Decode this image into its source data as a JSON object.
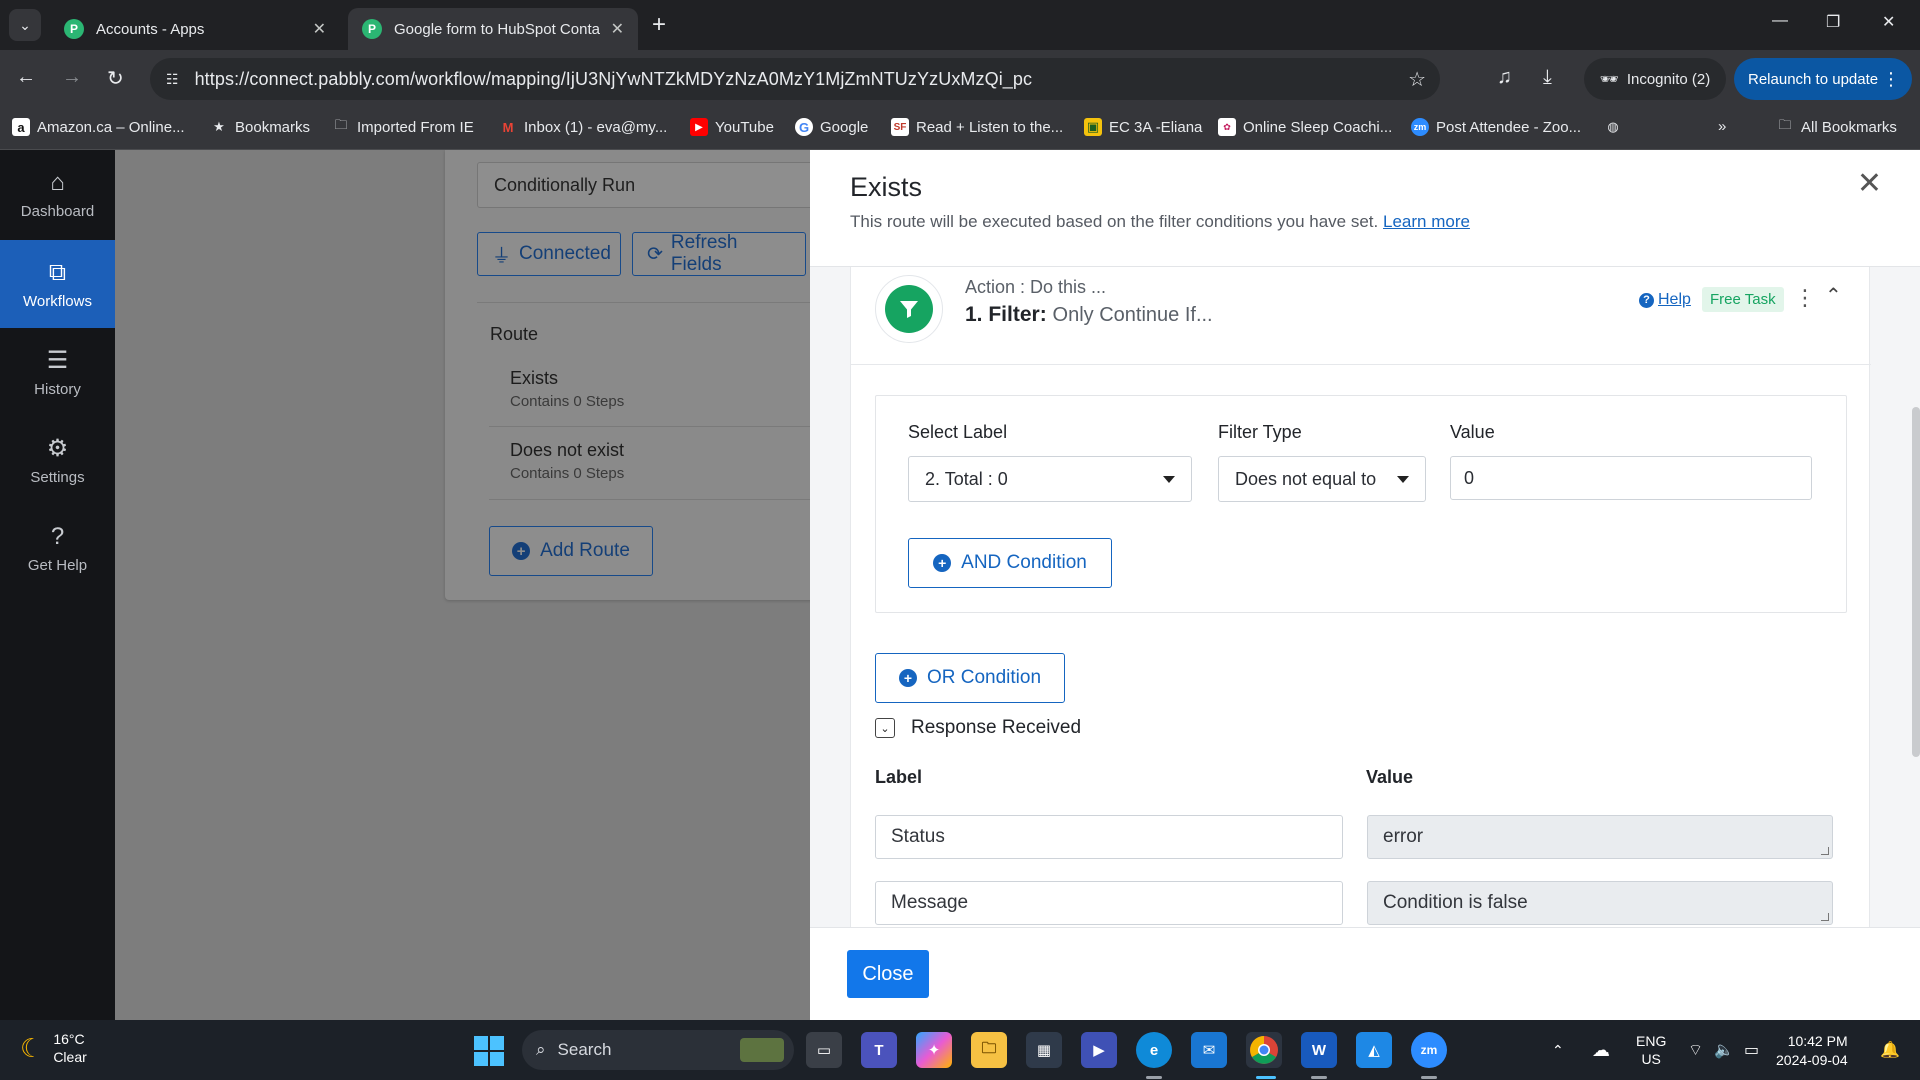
{
  "browser": {
    "tabs": [
      {
        "title": "Accounts - Apps",
        "active": false
      },
      {
        "title": "Google form to HubSpot Conta",
        "active": true
      }
    ],
    "url": "https://connect.pabbly.com/workflow/mapping/IjU3NjYwNTZkMDYzNzA0MzY1MjZmNTUzYzUxMzQi_pc",
    "incognito_label": "Incognito (2)",
    "relaunch_label": "Relaunch to update",
    "bookmarks": [
      "Amazon.ca – Online...",
      "Bookmarks",
      "Imported From IE",
      "Inbox (1) - eva@my...",
      "YouTube",
      "Google",
      "Read + Listen to the...",
      "EC 3A -Eliana",
      "Online Sleep Coachi...",
      "Post Attendee - Zoo..."
    ],
    "all_bookmarks_label": "All Bookmarks"
  },
  "sidebar": {
    "items": [
      {
        "label": "Dashboard",
        "icon": "home-icon"
      },
      {
        "label": "Workflows",
        "icon": "workflow-icon"
      },
      {
        "label": "History",
        "icon": "list-icon"
      },
      {
        "label": "Settings",
        "icon": "gear-icon"
      },
      {
        "label": "Get Help",
        "icon": "question-icon"
      }
    ],
    "active": "Workflows"
  },
  "background": {
    "action_event": "Conditionally Run",
    "connected_label": "Connected",
    "refresh_label": "Refresh Fields",
    "route_heading": "Route",
    "routes": [
      {
        "name": "Exists",
        "steps": "Contains 0 Steps"
      },
      {
        "name": "Does not exist",
        "steps": "Contains 0 Steps"
      }
    ],
    "add_route_label": "Add Route"
  },
  "panel": {
    "title": "Exists",
    "subtitle": "This route will be executed based on the filter conditions you have set.",
    "learn_more": "Learn more",
    "step": {
      "kicker": "Action : Do this ...",
      "title_bold": "1. Filter:",
      "title_rest": "Only Continue If...",
      "help_label": "Help",
      "badge": "Free Task"
    },
    "condition": {
      "label_heading": "Select Label",
      "label_value": "2. Total : 0",
      "type_heading": "Filter Type",
      "type_value": "Does not equal to",
      "value_heading": "Value",
      "value_value": "0",
      "and_label": "AND Condition"
    },
    "or_label": "OR Condition",
    "response": {
      "toggle_label": "Response Received",
      "label_heading": "Label",
      "value_heading": "Value",
      "rows": [
        {
          "label": "Status",
          "value": "error"
        },
        {
          "label": "Message",
          "value": "Condition is false"
        }
      ]
    },
    "close_label": "Close"
  },
  "taskbar": {
    "weather_temp": "16°C",
    "weather_desc": "Clear",
    "search_placeholder": "Search",
    "lang_top": "ENG",
    "lang_bottom": "US",
    "time": "10:42 PM",
    "date": "2024-09-04"
  },
  "colors": {
    "accent": "#1565c0",
    "close_button": "#1277ea",
    "sidebar_active": "#1c5fb8",
    "filter_green": "#16a461"
  }
}
